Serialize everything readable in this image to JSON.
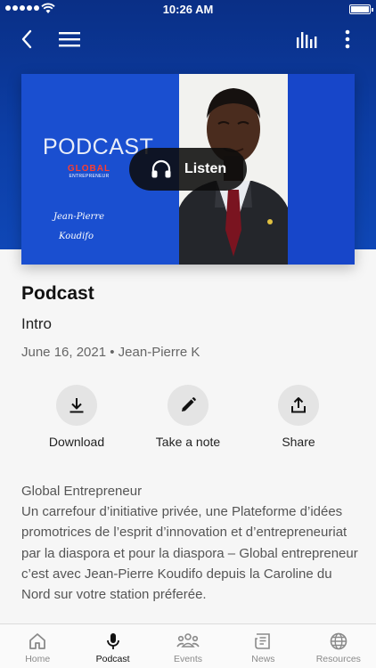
{
  "status_bar": {
    "time": "10:26 AM"
  },
  "artwork": {
    "podcast_word": "PODCAST",
    "logo_main": "GLOBAL",
    "logo_sub": "ENTREPRENEUR",
    "signature_line1": "Jean-Pierre",
    "signature_line2": "Koudifo"
  },
  "listen_label": "Listen",
  "episode": {
    "title": "Podcast",
    "subtitle": "Intro",
    "meta": "June 16, 2021 • Jean-Pierre K"
  },
  "actions": [
    {
      "label": "Download",
      "icon": "download-icon"
    },
    {
      "label": "Take a note",
      "icon": "pencil-icon"
    },
    {
      "label": "Share",
      "icon": "share-icon"
    }
  ],
  "description": "Global Entrepreneur\nUn carrefour d’initiative privée, une Plateforme d’idées promotrices de l’esprit d’innovation et d’entrepreneuriat par la diaspora et pour la diaspora – Global entrepreneur c’est avec Jean-Pierre Koudifo depuis la Caroline du Nord sur votre station préferée.",
  "tabs": [
    {
      "label": "Home",
      "icon": "home-icon",
      "active": false
    },
    {
      "label": "Podcast",
      "icon": "microphone-icon",
      "active": true
    },
    {
      "label": "Events",
      "icon": "people-icon",
      "active": false
    },
    {
      "label": "News",
      "icon": "newspaper-icon",
      "active": false
    },
    {
      "label": "Resources",
      "icon": "globe-icon",
      "active": false
    }
  ],
  "colors": {
    "header_blue": "#0c3ea6",
    "art_blue": "#1a4fd0",
    "logo_red": "#ff3d2e",
    "active_tab": "#111111",
    "inactive_tab": "#8a8a8a"
  }
}
